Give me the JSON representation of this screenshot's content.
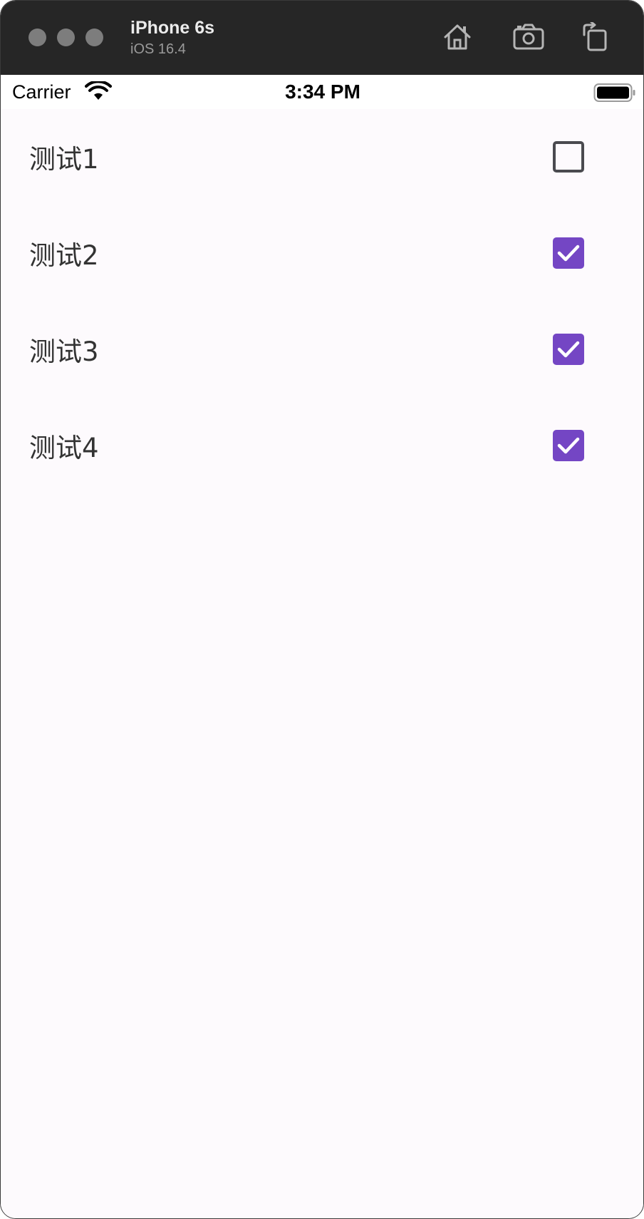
{
  "simulator": {
    "device_name": "iPhone 6s",
    "os_version": "iOS 16.4"
  },
  "status_bar": {
    "carrier": "Carrier",
    "time": "3:34 PM"
  },
  "list": {
    "accent_color": "#7446c4",
    "items": [
      {
        "label": "测试1",
        "checked": false
      },
      {
        "label": "测试2",
        "checked": true
      },
      {
        "label": "测试3",
        "checked": true
      },
      {
        "label": "测试4",
        "checked": true
      }
    ]
  }
}
